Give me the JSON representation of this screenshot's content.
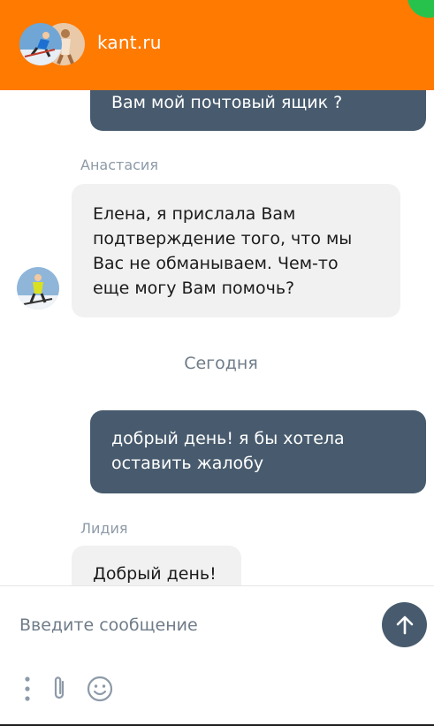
{
  "header": {
    "brand": "kant.ru",
    "brand_color": "#ff7a00"
  },
  "messages": [
    {
      "direction": "out",
      "author": "",
      "text": "Вам мой почтовый ящик ?"
    },
    {
      "direction": "in",
      "author": "Анастасия",
      "text": "Елена, я прислала Вам подтверждение того, что мы Вас не обманываем. Чем-то еще могу Вам помочь?"
    },
    {
      "direction": "separator",
      "text": "Сегодня"
    },
    {
      "direction": "out",
      "author": "",
      "text": "добрый день! я бы хотела оставить жалобу"
    },
    {
      "direction": "in",
      "author": "Лидия",
      "text": "Добрый день!"
    }
  ],
  "composer": {
    "placeholder": "Введите сообщение",
    "value": "",
    "send_icon": "arrow-up-icon",
    "tools": [
      "more-dots-icon",
      "paperclip-icon",
      "emoji-icon"
    ]
  },
  "colors": {
    "outgoing_bubble": "#485b6e",
    "incoming_bubble": "#f1f1f1",
    "author_name": "#8d9aa8",
    "status_dot": "#27c24c"
  }
}
